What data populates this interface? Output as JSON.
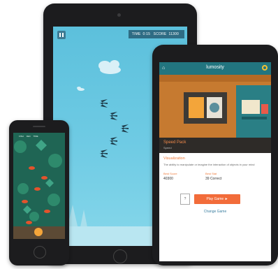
{
  "colors": {
    "sky": "#6fcbe4",
    "lumosity_teal": "#22757f",
    "accent_orange": "#ef7a3a",
    "play_button": "#f26c3a",
    "pond_green": "#1f6554"
  },
  "game": {
    "time_label": "TIME",
    "time_value": "0:15",
    "score_label": "SCORE",
    "score_value": "11300"
  },
  "app": {
    "title": "lumosity",
    "pack_name": "Speed Pack",
    "pack_subtitle": "Speed",
    "skill_heading": "Visualization",
    "skill_desc": "The ability to manipulate or imagine the interaction of objects in your mind",
    "best_score_label": "Best Score",
    "best_score_value": "40300",
    "best_stat_label": "Best Stat",
    "best_stat_value": "39 Correct",
    "lock_icon": "?",
    "play_label": "Play Game ►",
    "change_label": "Change Game"
  },
  "phone_game": {
    "hud_items": [
      "FISH",
      "FED",
      "TIME"
    ]
  }
}
